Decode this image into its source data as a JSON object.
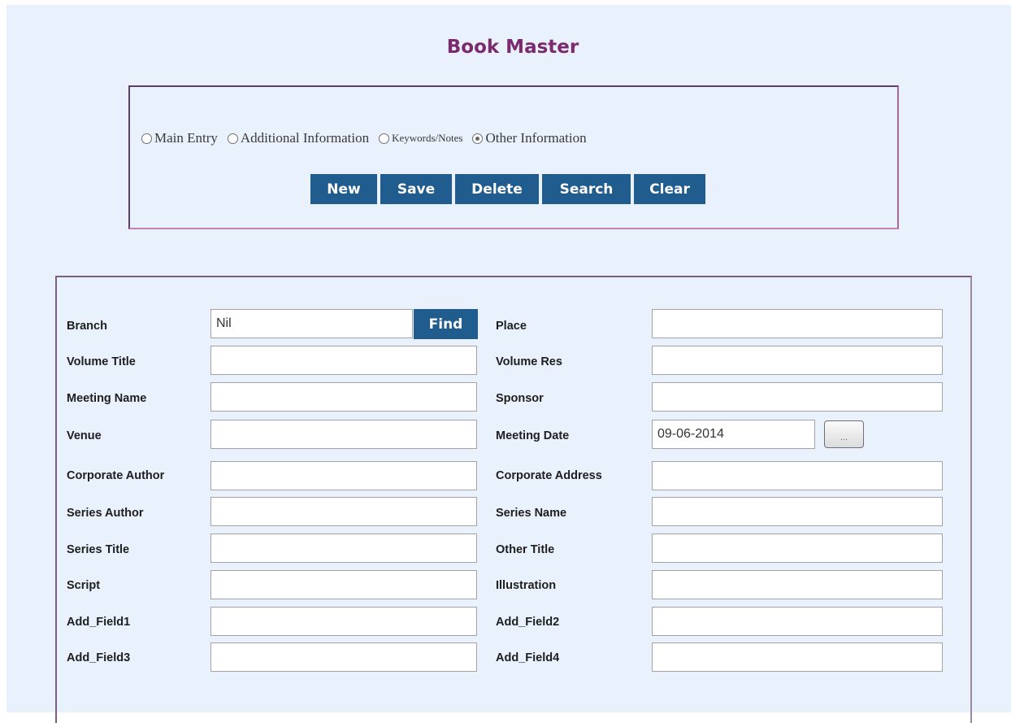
{
  "page": {
    "title": "Book Master"
  },
  "radios": [
    {
      "label": "Main Entry",
      "checked": false
    },
    {
      "label": "Additional Information",
      "checked": false
    },
    {
      "label": "Keywords/Notes",
      "checked": false
    },
    {
      "label": "Other Information",
      "checked": true
    }
  ],
  "buttons": {
    "new": "New",
    "save": "Save",
    "delete": "Delete",
    "search": "Search",
    "clear": "Clear",
    "find": "Find",
    "date_picker": "..."
  },
  "fields": {
    "branch": {
      "label": "Branch",
      "value": "Nil"
    },
    "place": {
      "label": "Place",
      "value": ""
    },
    "volume_title": {
      "label": "Volume Title",
      "value": ""
    },
    "volume_res": {
      "label": "Volume Res",
      "value": ""
    },
    "meeting_name": {
      "label": "Meeting Name",
      "value": ""
    },
    "sponsor": {
      "label": "Sponsor",
      "value": ""
    },
    "venue": {
      "label": "Venue",
      "value": ""
    },
    "meeting_date": {
      "label": "Meeting Date",
      "value": "09-06-2014"
    },
    "corporate_author": {
      "label": "Corporate Author",
      "value": ""
    },
    "corporate_address": {
      "label": "Corporate Address",
      "value": ""
    },
    "series_author": {
      "label": "Series Author",
      "value": ""
    },
    "series_name": {
      "label": "Series Name",
      "value": ""
    },
    "series_title": {
      "label": "Series Title",
      "value": ""
    },
    "other_title": {
      "label": "Other Title",
      "value": ""
    },
    "script": {
      "label": "Script",
      "value": ""
    },
    "illustration": {
      "label": "Illustration",
      "value": ""
    },
    "add_field1": {
      "label": "Add_Field1",
      "value": ""
    },
    "add_field2": {
      "label": "Add_Field2",
      "value": ""
    },
    "add_field3": {
      "label": "Add_Field3",
      "value": ""
    },
    "add_field4": {
      "label": "Add_Field4",
      "value": ""
    }
  }
}
